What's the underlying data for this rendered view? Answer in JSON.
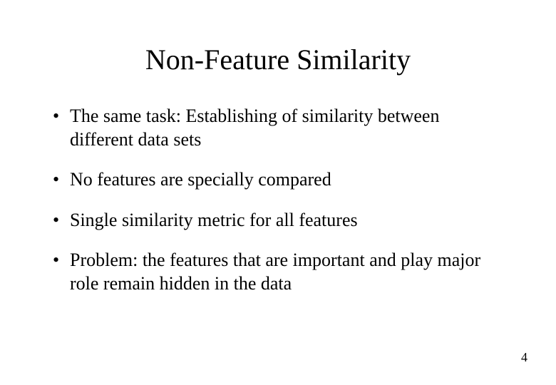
{
  "title": "Non-Feature Similarity",
  "bullets": [
    "The same task: Establishing of similarity between different data sets",
    "No features are specially compared",
    "Single similarity metric for all features",
    "Problem: the features that are important and play major role remain hidden in the data"
  ],
  "page_number": "4"
}
